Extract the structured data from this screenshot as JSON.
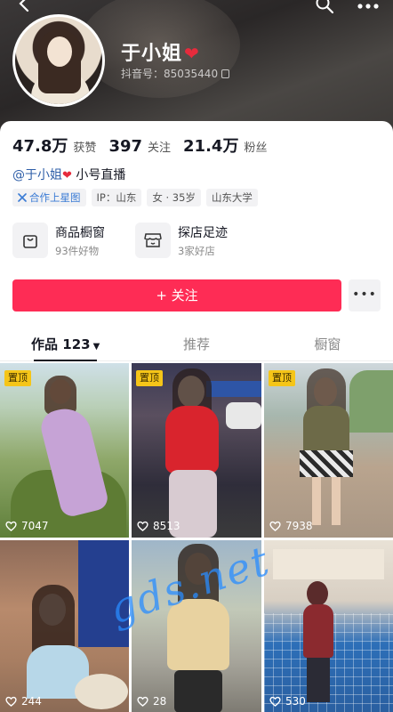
{
  "header": {
    "name": "于小姐",
    "douyin_id": "抖音号：85035440"
  },
  "stats": [
    {
      "value": "47.8万",
      "label": "获赞"
    },
    {
      "value": "397",
      "label": "关注"
    },
    {
      "value": "21.4万",
      "label": "粉丝"
    }
  ],
  "bio": {
    "mention": "@于小姐",
    "text": "小号直播"
  },
  "tags": [
    {
      "label": "合作上星图",
      "icon": "star-graph-icon"
    },
    {
      "label": "IP：山东"
    },
    {
      "label": "女 · 35岁"
    },
    {
      "label": "山东大学"
    }
  ],
  "shop": {
    "window_title": "商品橱窗",
    "window_sub": "93件好物",
    "visit_title": "探店足迹",
    "visit_sub": "3家好店"
  },
  "actions": {
    "follow": "+ 关注",
    "more": "•••"
  },
  "tabs": [
    {
      "label": "作品 123",
      "active": true
    },
    {
      "label": "推荐",
      "active": false
    },
    {
      "label": "橱窗",
      "active": false
    }
  ],
  "videos": [
    {
      "pinned": "置顶",
      "likes": "7047"
    },
    {
      "pinned": "置顶",
      "likes": "8513"
    },
    {
      "pinned": "置顶",
      "likes": "7938"
    },
    {
      "likes": "244"
    },
    {
      "likes": "28"
    },
    {
      "likes": "530"
    }
  ],
  "watermark": "gds.net",
  "colors": {
    "follow_button": "#fe2c55",
    "pin_badge": "#f5c518",
    "mention": "#2f5fa8"
  }
}
